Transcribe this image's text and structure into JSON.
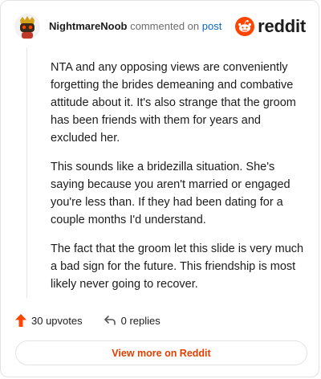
{
  "comment": {
    "author": "NightmareNoob",
    "verb": "commented on",
    "post_link": "post",
    "paragraphs": [
      "NTA and any opposing views are conveniently forgetting the brides demeaning and combative attitude about it. It's also strange that the groom has been friends with them for years and excluded her.",
      "This sounds like a bridezilla situation. She's saying because you aren't married or engaged you're less than. If they had been dating for a couple months I'd understand.",
      "The fact that the groom let this slide is very much a bad sign for the future. This friendship is most likely never going to recover."
    ]
  },
  "brand": {
    "name": "reddit",
    "icon": "reddit-logo-icon",
    "color": "#ff4500"
  },
  "actions": {
    "upvotes": "30 upvotes",
    "replies": "0 replies"
  },
  "view_more": "View more on Reddit",
  "colors": {
    "accent": "#e03f00",
    "upvote": "#ff4500",
    "link": "#0a66c2"
  }
}
